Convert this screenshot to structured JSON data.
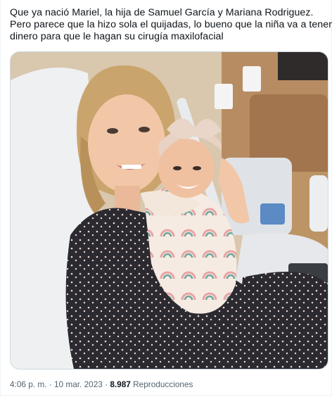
{
  "tweet": {
    "text_lines": [
      "Que ya nació Mariel, la hija de Samuel García y Mariana Rodriguez.",
      "Pero parece que la hizo sola el quijadas, lo bueno que la niña va a tener",
      "dinero para que le hagan su cirugía maxilofacial"
    ],
    "media": {
      "alt": "photo",
      "colors": {
        "wall": "#d9c7ae",
        "sheet": "#eef0f2",
        "dress": "#2b2a30",
        "hair": "#c9a46c",
        "skin": "#f1c7a8",
        "wrap": "#f3e6da",
        "rainbow_pink": "#e8a3a3",
        "rainbow_teal": "#6fa59c",
        "chair": "#a2754e"
      }
    },
    "meta": {
      "time": "4:06 p. m.",
      "separator": "·",
      "date": "10 mar. 2023",
      "views_count": "8.987",
      "views_label": "Reproducciones"
    }
  }
}
